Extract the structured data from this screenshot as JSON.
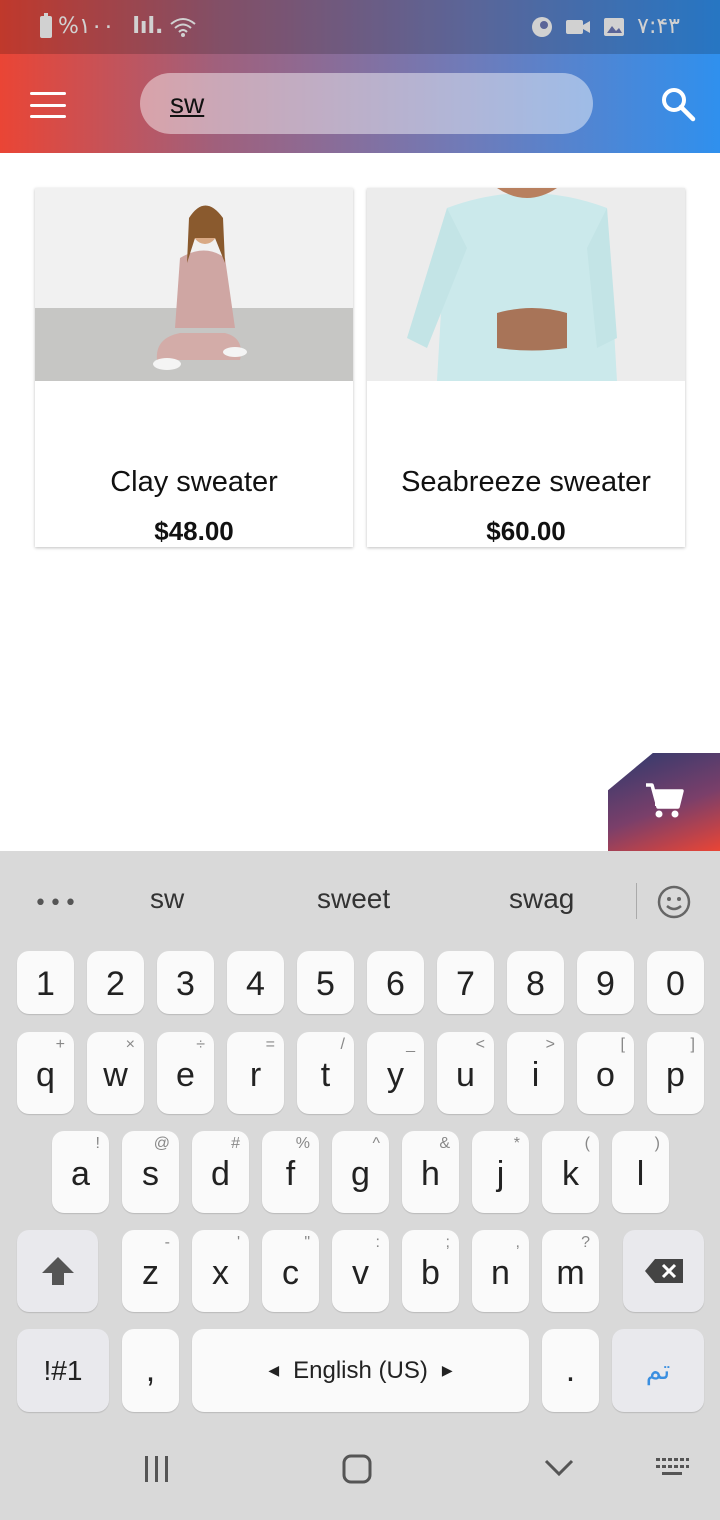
{
  "status_bar": {
    "battery": "%۱۰۰",
    "signal": "lıl.",
    "time": "۷:۴۳"
  },
  "search": {
    "value": "sw"
  },
  "products": [
    {
      "name": "Clay sweater",
      "price": "$48.00"
    },
    {
      "name": "Seabreeze sweater",
      "price": "$60.00"
    }
  ],
  "keyboard": {
    "suggestions": [
      "sw",
      "sweet",
      "swag"
    ],
    "number_row": [
      "1",
      "2",
      "3",
      "4",
      "5",
      "6",
      "7",
      "8",
      "9",
      "0"
    ],
    "row1": [
      {
        "key": "q",
        "sub": "+"
      },
      {
        "key": "w",
        "sub": "×"
      },
      {
        "key": "e",
        "sub": "÷"
      },
      {
        "key": "r",
        "sub": "="
      },
      {
        "key": "t",
        "sub": "/"
      },
      {
        "key": "y",
        "sub": "_"
      },
      {
        "key": "u",
        "sub": "<"
      },
      {
        "key": "i",
        "sub": ">"
      },
      {
        "key": "o",
        "sub": "["
      },
      {
        "key": "p",
        "sub": "]"
      }
    ],
    "row2": [
      {
        "key": "a",
        "sub": "!"
      },
      {
        "key": "s",
        "sub": "@"
      },
      {
        "key": "d",
        "sub": "#"
      },
      {
        "key": "f",
        "sub": "%"
      },
      {
        "key": "g",
        "sub": "^"
      },
      {
        "key": "h",
        "sub": "&"
      },
      {
        "key": "j",
        "sub": "*"
      },
      {
        "key": "k",
        "sub": "("
      },
      {
        "key": "l",
        "sub": ")"
      }
    ],
    "row3": [
      {
        "key": "z",
        "sub": "-"
      },
      {
        "key": "x",
        "sub": "'"
      },
      {
        "key": "c",
        "sub": "\""
      },
      {
        "key": "v",
        "sub": ":"
      },
      {
        "key": "b",
        "sub": ";"
      },
      {
        "key": "n",
        "sub": ","
      },
      {
        "key": "m",
        "sub": "?"
      }
    ],
    "symbols_label": "!#1",
    "comma": ",",
    "space_label": "English (US)",
    "period": ".",
    "done_label": "تم"
  },
  "colors": {
    "accent_red": "#ea4535",
    "accent_blue": "#2f90ee",
    "done_blue": "#3b8fe0"
  },
  "icons": [
    "menu-icon",
    "search-icon",
    "cart-icon",
    "shift-icon",
    "backspace-icon",
    "emoji-icon",
    "more-icon",
    "recents-icon",
    "home-icon",
    "back-icon",
    "keyboard-icon"
  ]
}
